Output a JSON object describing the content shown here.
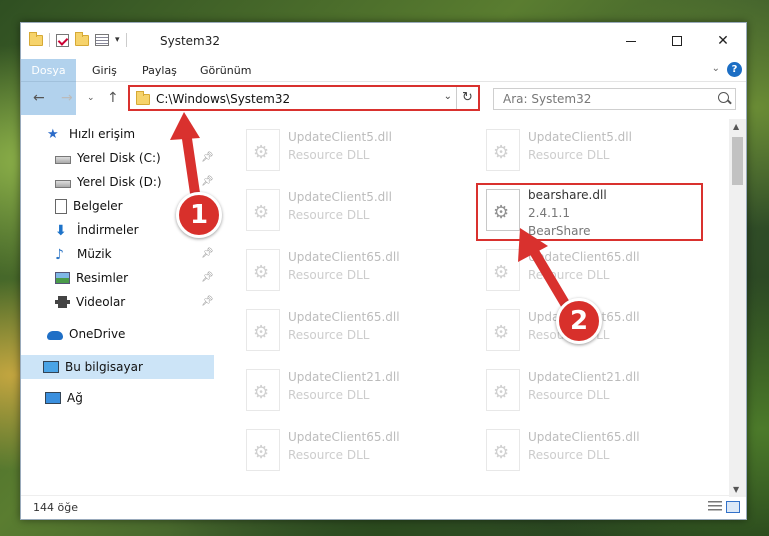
{
  "window": {
    "title": "System32"
  },
  "ribbon": {
    "tabs": [
      "Dosya",
      "Giriş",
      "Paylaş",
      "Görünüm"
    ]
  },
  "address": {
    "path": "C:\\Windows\\System32"
  },
  "search": {
    "placeholder": "Ara: System32"
  },
  "sidebar": {
    "quick_access": "Hızlı erişim",
    "items": [
      {
        "label": "Yerel Disk (C:)",
        "icon": "drive-icon",
        "pinned": true
      },
      {
        "label": "Yerel Disk (D:)",
        "icon": "drive-icon",
        "pinned": true
      },
      {
        "label": "Belgeler",
        "icon": "document-icon",
        "pinned": true
      },
      {
        "label": "İndirmeler",
        "icon": "download-icon",
        "pinned": true
      },
      {
        "label": "Müzik",
        "icon": "music-icon",
        "pinned": true
      },
      {
        "label": "Resimler",
        "icon": "pictures-icon",
        "pinned": true
      },
      {
        "label": "Videolar",
        "icon": "videos-icon",
        "pinned": true
      }
    ],
    "onedrive": "OneDrive",
    "this_pc": "Bu bilgisayar",
    "network": "Ağ"
  },
  "files": [
    {
      "name": "UpdateClient5.dll",
      "desc": "Resource DLL"
    },
    {
      "name": "UpdateClient5.dll",
      "desc": "Resource DLL"
    },
    {
      "name": "UpdateClient5.dll",
      "desc": "Resource DLL"
    },
    {
      "name": "UpdateClient65.dll",
      "desc": "Resource DLL"
    },
    {
      "name": "UpdateClient65.dll",
      "desc": "Resource DLL"
    },
    {
      "name": "UpdateClient65.dll",
      "desc": "Resource DLL"
    },
    {
      "name": "UpdateClient65.dll",
      "desc": "Resource DLL"
    },
    {
      "name": "UpdateClient21.dll",
      "desc": "Resource DLL"
    },
    {
      "name": "UpdateClient21.dll",
      "desc": "Resource DLL"
    },
    {
      "name": "UpdateClient65.dll",
      "desc": "Resource DLL"
    },
    {
      "name": "UpdateClient65.dll",
      "desc": "Resource DLL"
    }
  ],
  "highlighted_file": {
    "name": "bearshare.dll",
    "version": "2.4.1.1",
    "company": "BearShare"
  },
  "status": {
    "count": "144 öğe"
  },
  "markers": {
    "one": "1",
    "two": "2"
  },
  "colors": {
    "accent": "#1979ca",
    "highlight_red": "#d9312e"
  }
}
